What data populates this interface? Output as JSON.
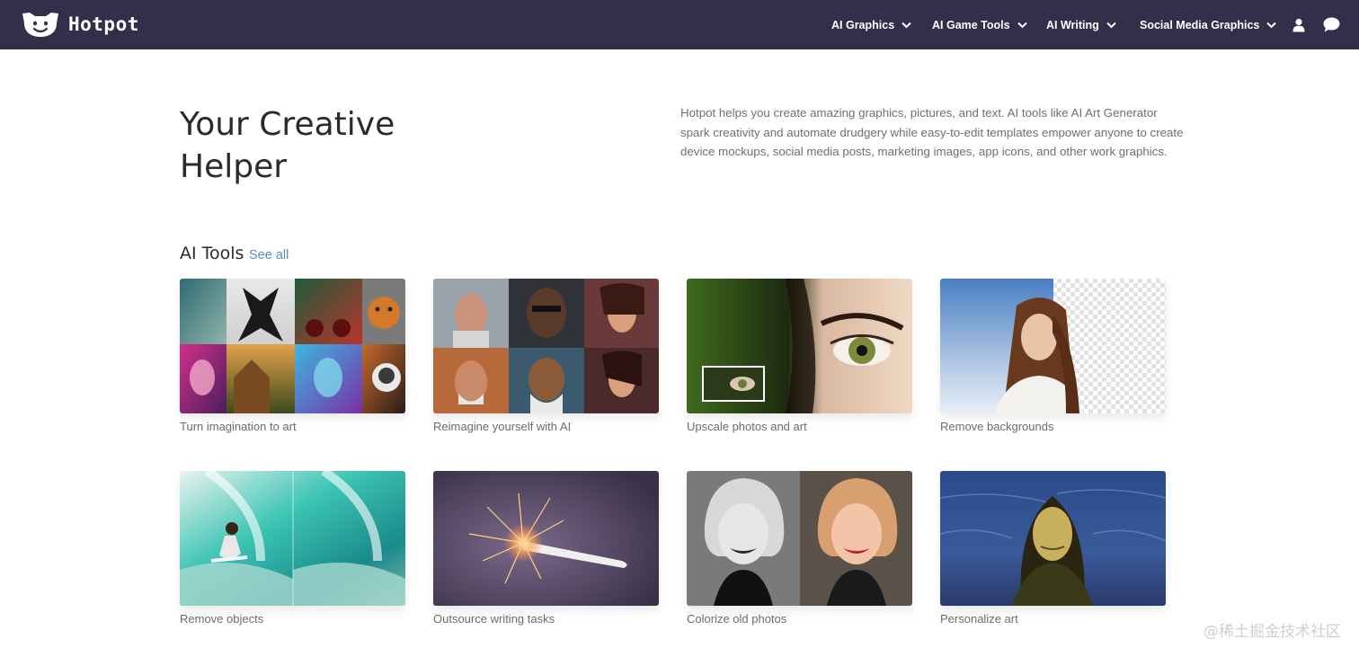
{
  "brand": {
    "name": "Hotpot"
  },
  "nav": {
    "items": [
      {
        "label": "AI Graphics"
      },
      {
        "label": "AI Game Tools"
      },
      {
        "label": "AI Writing"
      },
      {
        "label": "Social Media Graphics"
      }
    ],
    "icons": [
      "user-icon",
      "chat-icon"
    ]
  },
  "hero": {
    "title": "Your Creative Helper",
    "description": "Hotpot helps you create amazing graphics, pictures, and text. AI tools like AI Art Generator spark creativity and automate drudgery while easy-to-edit templates empower anyone to create device mockups, social media posts, marketing images, app icons, and other work graphics."
  },
  "section": {
    "title": "AI Tools",
    "see_all": "See all"
  },
  "cards": [
    {
      "caption": "Turn imagination to art"
    },
    {
      "caption": "Reimagine yourself with AI"
    },
    {
      "caption": "Upscale photos and art"
    },
    {
      "caption": "Remove backgrounds"
    },
    {
      "caption": "Remove objects"
    },
    {
      "caption": "Outsource writing tasks"
    },
    {
      "caption": "Colorize old photos"
    },
    {
      "caption": "Personalize art"
    }
  ],
  "watermark": "@稀土掘金技术社区",
  "colors": {
    "navbar": "#332e4a",
    "link": "#5b8bb8",
    "caption": "#6c6c6c"
  }
}
